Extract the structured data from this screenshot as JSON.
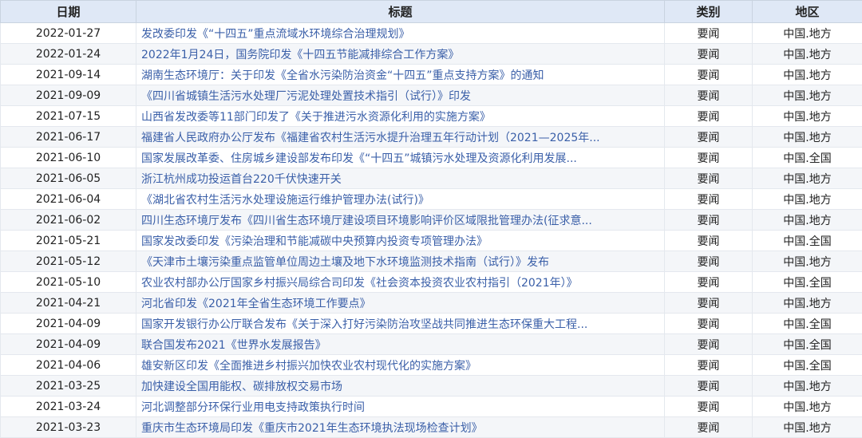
{
  "table": {
    "headers": [
      "日期",
      "标题",
      "类别",
      "地区"
    ],
    "rows": [
      {
        "date": "2022-01-27",
        "title": "发改委印发《“十四五”重点流域水环境综合治理规划》",
        "type": "要闻",
        "region": "中国.地方"
      },
      {
        "date": "2022-01-24",
        "title": "2022年1月24日，国务院印发《十四五节能减排综合工作方案》",
        "type": "要闻",
        "region": "中国.地方"
      },
      {
        "date": "2021-09-14",
        "title": "湖南生态环境厅：关于印发《全省水污染防治资金“十四五”重点支持方案》的通知",
        "type": "要闻",
        "region": "中国.地方"
      },
      {
        "date": "2021-09-09",
        "title": "《四川省城镇生活污水处理厂污泥处理处置技术指引（试行）》印发",
        "type": "要闻",
        "region": "中国.地方"
      },
      {
        "date": "2021-07-15",
        "title": "山西省发改委等11部门印发了《关于推进污水资源化利用的实施方案》",
        "type": "要闻",
        "region": "中国.地方"
      },
      {
        "date": "2021-06-17",
        "title": "福建省人民政府办公厅发布《福建省农村生活污水提升治理五年行动计划（2021—2025年...",
        "type": "要闻",
        "region": "中国.地方"
      },
      {
        "date": "2021-06-10",
        "title": "国家发展改革委、住房城乡建设部发布印发《“十四五”城镇污水处理及资源化利用发展...",
        "type": "要闻",
        "region": "中国.全国"
      },
      {
        "date": "2021-06-05",
        "title": "浙江杭州成功投运首台220千伏快速开关",
        "type": "要闻",
        "region": "中国.地方"
      },
      {
        "date": "2021-06-04",
        "title": "《湖北省农村生活污水处理设施运行维护管理办法(试行)》",
        "type": "要闻",
        "region": "中国.地方"
      },
      {
        "date": "2021-06-02",
        "title": "四川生态环境厅发布《四川省生态环境厅建设项目环境影响评价区域限批管理办法(征求意...",
        "type": "要闻",
        "region": "中国.地方"
      },
      {
        "date": "2021-05-21",
        "title": "国家发改委印发《污染治理和节能减碳中央预算内投资专项管理办法》",
        "type": "要闻",
        "region": "中国.全国"
      },
      {
        "date": "2021-05-12",
        "title": "《天津市土壤污染重点监管单位周边土壤及地下水环境监测技术指南（试行）》发布",
        "type": "要闻",
        "region": "中国.地方"
      },
      {
        "date": "2021-05-10",
        "title": "农业农村部办公厅国家乡村振兴局综合司印发《社会资本投资农业农村指引（2021年）》",
        "type": "要闻",
        "region": "中国.全国"
      },
      {
        "date": "2021-04-21",
        "title": "河北省印发《2021年全省生态环境工作要点》",
        "type": "要闻",
        "region": "中国.地方"
      },
      {
        "date": "2021-04-09",
        "title": "国家开发银行办公厅联合发布《关于深入打好污染防治攻坚战共同推进生态环保重大工程...",
        "type": "要闻",
        "region": "中国.全国"
      },
      {
        "date": "2021-04-09",
        "title": "联合国发布2021《世界水发展报告》",
        "type": "要闻",
        "region": "中国.全国"
      },
      {
        "date": "2021-04-06",
        "title": "雄安新区印发《全面推进乡村振兴加快农业农村现代化的实施方案》",
        "type": "要闻",
        "region": "中国.全国"
      },
      {
        "date": "2021-03-25",
        "title": "加快建设全国用能权、碳排放权交易市场",
        "type": "要闻",
        "region": "中国.地方"
      },
      {
        "date": "2021-03-24",
        "title": "河北调整部分环保行业用电支持政策执行时间",
        "type": "要闻",
        "region": "中国.地方"
      },
      {
        "date": "2021-03-23",
        "title": "重庆市生态环境局印发《重庆市2021年生态环境执法现场检查计划》",
        "type": "要闻",
        "region": "中国.地方"
      }
    ]
  },
  "colors": {
    "header_bg": "#dfe8f6",
    "link": "#3a5fa8",
    "stripe": "#f4f6f9"
  }
}
